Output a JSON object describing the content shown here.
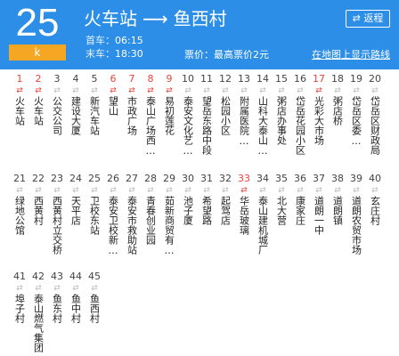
{
  "header": {
    "route_number": "25",
    "route_sub": "k",
    "origin": "火车站",
    "destination": "鱼西村",
    "arrow": "⟶",
    "first_bus_label": "首车：",
    "first_bus_time": "06:15",
    "last_bus_label": "末车：",
    "last_bus_time": "18:30",
    "fare_text": "票价：最高票价2元",
    "return_label": "⇄ 返程",
    "map_link": "在地图上显示路线",
    "bg_color": "#2c8ee6",
    "badge_color": "#f5a623"
  },
  "stop_icon": "⇄",
  "stops": [
    {
      "n": "1",
      "name": "火车站",
      "red": true
    },
    {
      "n": "2",
      "name": "火车站",
      "red": true
    },
    {
      "n": "3",
      "name": "公交公司",
      "red": false
    },
    {
      "n": "4",
      "name": "建设大厦",
      "red": false
    },
    {
      "n": "5",
      "name": "新汽车站",
      "red": false
    },
    {
      "n": "6",
      "name": "望山",
      "red": true
    },
    {
      "n": "7",
      "name": "市政广场",
      "red": true
    },
    {
      "n": "8",
      "name": "泰山广场西…",
      "red": true
    },
    {
      "n": "9",
      "name": "易初莲花",
      "red": true
    },
    {
      "n": "10",
      "name": "泰安文化艺…",
      "red": false
    },
    {
      "n": "11",
      "name": "望岳东路中段",
      "red": false
    },
    {
      "n": "12",
      "name": "松园小区",
      "red": false
    },
    {
      "n": "13",
      "name": "附属医院…",
      "red": false
    },
    {
      "n": "14",
      "name": "山科大泰山…",
      "red": false
    },
    {
      "n": "15",
      "name": "粥店办事处",
      "red": false
    },
    {
      "n": "16",
      "name": "岱岳花园小区",
      "red": false
    },
    {
      "n": "17",
      "name": "光彩大市场",
      "red": true
    },
    {
      "n": "18",
      "name": "粥店桥",
      "red": false
    },
    {
      "n": "19",
      "name": "岱岳区委…",
      "red": false
    },
    {
      "n": "20",
      "name": "岱岳区财政局",
      "red": false
    },
    {
      "n": "21",
      "name": "绿地公馆",
      "red": false
    },
    {
      "n": "22",
      "name": "西黄村",
      "red": false
    },
    {
      "n": "23",
      "name": "西黄村立交桥",
      "red": false
    },
    {
      "n": "24",
      "name": "天平店",
      "red": false
    },
    {
      "n": "25",
      "name": "卫校东站",
      "red": false
    },
    {
      "n": "26",
      "name": "泰安卫校新…",
      "red": false
    },
    {
      "n": "27",
      "name": "泰安市救助站",
      "red": false
    },
    {
      "n": "28",
      "name": "青春创业园",
      "red": false
    },
    {
      "n": "29",
      "name": "茹新商贸有…",
      "red": false
    },
    {
      "n": "30",
      "name": "池子厦",
      "red": false
    },
    {
      "n": "31",
      "name": "希望路",
      "red": false
    },
    {
      "n": "32",
      "name": "起驾店",
      "red": false
    },
    {
      "n": "33",
      "name": "华岳玻璃",
      "red": true
    },
    {
      "n": "34",
      "name": "泰山建机城厂",
      "red": false
    },
    {
      "n": "35",
      "name": "北大营",
      "red": false
    },
    {
      "n": "36",
      "name": "康家庄",
      "red": false
    },
    {
      "n": "37",
      "name": "道朗一中",
      "red": false
    },
    {
      "n": "38",
      "name": "道朗镇",
      "red": false
    },
    {
      "n": "39",
      "name": "道朗农贸市场",
      "red": false
    },
    {
      "n": "40",
      "name": "玄庄村",
      "red": false
    },
    {
      "n": "41",
      "name": "埠子村",
      "red": false
    },
    {
      "n": "42",
      "name": "泰山燃气集团",
      "red": false
    },
    {
      "n": "43",
      "name": "鱼东村",
      "red": false
    },
    {
      "n": "44",
      "name": "鱼中村",
      "red": false
    },
    {
      "n": "45",
      "name": "鱼西村",
      "red": false
    }
  ]
}
